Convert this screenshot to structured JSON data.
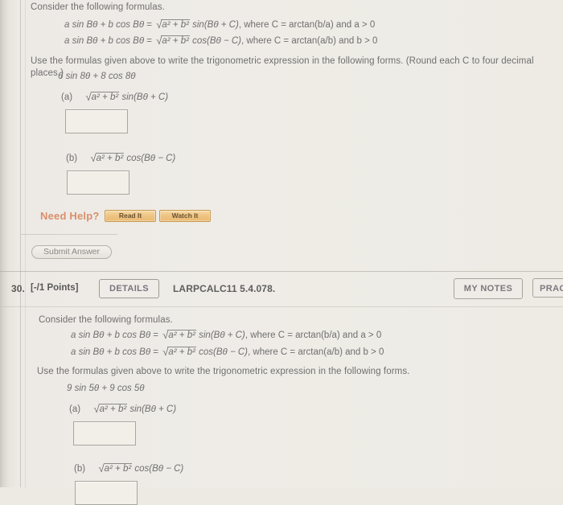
{
  "background": {
    "page": "#eeebe5",
    "accent_orange": "#d98f6b",
    "expression_red": "#c08b90"
  },
  "problem_top": {
    "intro": "Consider the following formulas.",
    "formula1": {
      "lhs": "a sin Bθ + b cos Bθ",
      "eq": "=",
      "radical": "a² + b²",
      "trig": "sin(Bθ + C)",
      "condition": ", where C = arctan(b/a) and a > 0"
    },
    "formula2": {
      "lhs": "a sin Bθ + b cos Bθ",
      "eq": "=",
      "radical": "a² + b²",
      "trig": "cos(Bθ − C)",
      "condition": ", where C = arctan(a/b) and b > 0"
    },
    "instruction": "Use the formulas given above to write the trigonometric expression in the following forms. (Round each C to four decimal places.)",
    "expression": "6 sin 8θ + 8 cos 8θ",
    "parts": [
      {
        "label": "(a)",
        "radical": "a² + b²",
        "trig": "sin(Bθ + C)",
        "answer": ""
      },
      {
        "label": "(b)",
        "radical": "a² + b²",
        "trig": "cos(Bθ − C)",
        "answer": ""
      }
    ],
    "need_help_label": "Need Help?",
    "read_it_label": "Read It",
    "watch_it_label": "Watch It",
    "submit_label": "Submit Answer"
  },
  "header30": {
    "number": "30.",
    "points": "[-/1 Points]",
    "details_label": "DETAILS",
    "source_code": "LARPCALC11 5.4.078.",
    "my_notes_label": "MY NOTES",
    "practice_label": "PRACTICE ANOTHER"
  },
  "problem_bottom": {
    "intro": "Consider the following formulas.",
    "formula1": {
      "lhs": "a sin Bθ + b cos Bθ",
      "eq": "=",
      "radical": "a² + b²",
      "trig": "sin(Bθ + C)",
      "condition": ", where C = arctan(b/a) and a > 0"
    },
    "formula2": {
      "lhs": "a sin Bθ + b cos Bθ",
      "eq": "=",
      "radical": "a² + b²",
      "trig": "cos(Bθ − C)",
      "condition": ", where C = arctan(a/b) and b > 0"
    },
    "instruction": "Use the formulas given above to write the trigonometric expression in the following forms.",
    "expression": "9 sin 5θ + 9 cos 5θ",
    "parts": [
      {
        "label": "(a)",
        "radical": "a² + b²",
        "trig": "sin(Bθ + C)",
        "answer": ""
      },
      {
        "label": "(b)",
        "radical": "a² + b²",
        "trig": "cos(Bθ − C)",
        "answer": ""
      }
    ]
  }
}
